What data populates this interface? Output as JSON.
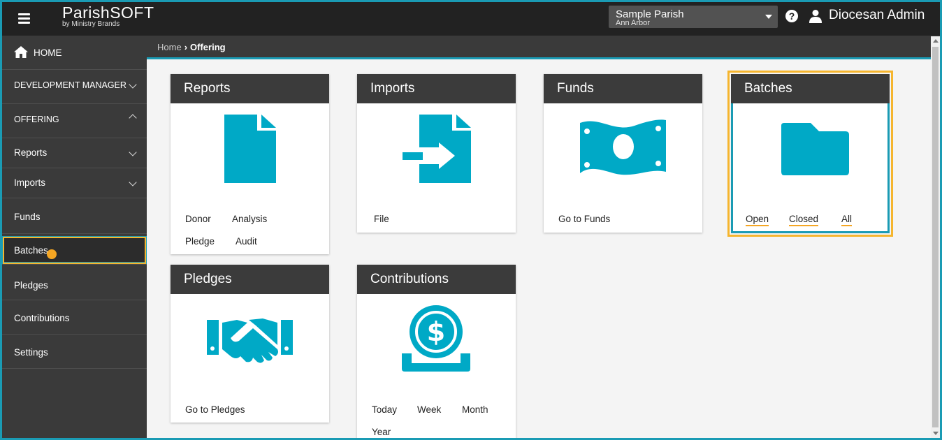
{
  "app": {
    "logo_main": "ParishSOFT",
    "logo_sub": "by Ministry Brands"
  },
  "header": {
    "parish_name": "Sample Parish",
    "parish_location": "Ann Arbor",
    "user_name": "Diocesan Admin"
  },
  "sidebar": {
    "home": "HOME",
    "development_manager": "DEVELOPMENT MANAGER",
    "offering": "OFFERING",
    "items": [
      "Reports",
      "Imports",
      "Funds",
      "Batches",
      "Pledges",
      "Contributions",
      "Settings"
    ]
  },
  "breadcrumb": {
    "home": "Home",
    "current": "Offering"
  },
  "cards": {
    "reports": {
      "title": "Reports",
      "links": [
        "Donor",
        "Analysis",
        "Pledge",
        "Audit"
      ]
    },
    "imports": {
      "title": "Imports",
      "links": [
        "File"
      ]
    },
    "funds": {
      "title": "Funds",
      "links": [
        "Go to Funds"
      ]
    },
    "batches": {
      "title": "Batches",
      "links": [
        "Open",
        "Closed",
        "All"
      ]
    },
    "pledges": {
      "title": "Pledges",
      "links": [
        "Go to Pledges"
      ]
    },
    "contributions": {
      "title": "Contributions",
      "links": [
        "Today",
        "Week",
        "Month",
        "Year"
      ]
    }
  },
  "colors": {
    "accent": "#00a9c6",
    "highlight": "#f5b52e",
    "dark": "#222222"
  }
}
